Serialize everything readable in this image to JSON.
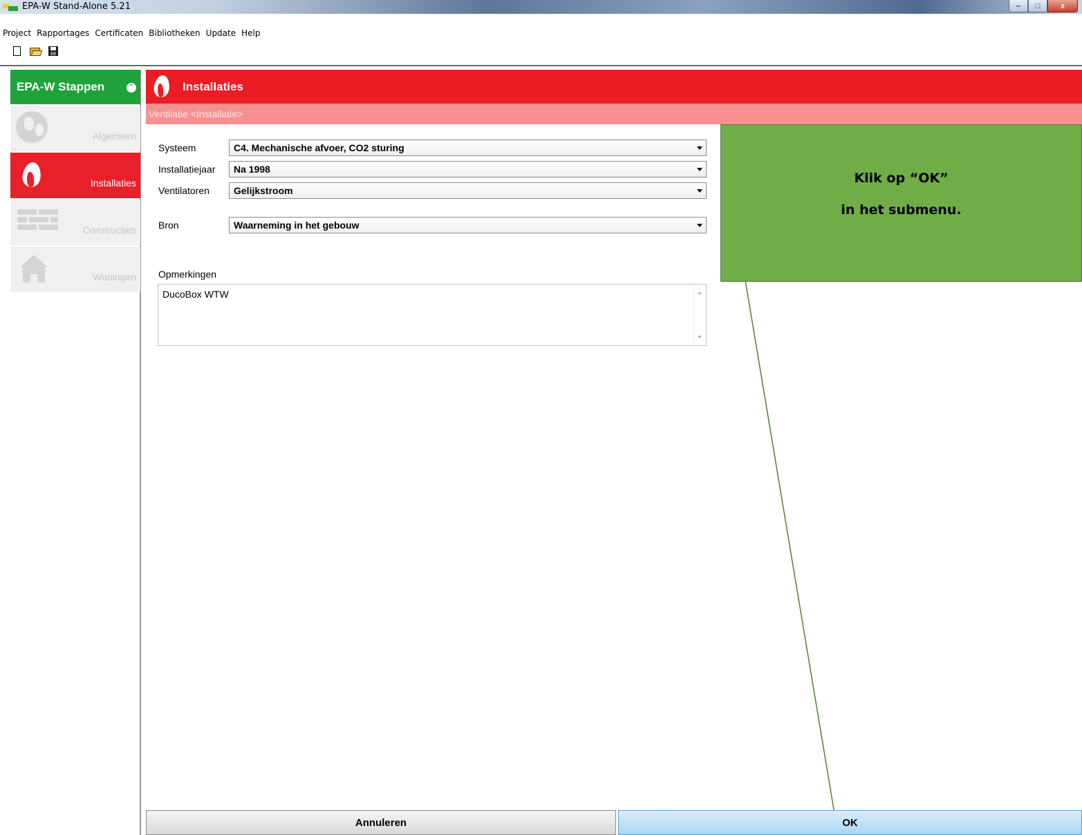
{
  "window": {
    "title": "EPA-W Stand-Alone 5.21",
    "minimize_glyph": "‒",
    "maximize_glyph": "□",
    "close_glyph": "x"
  },
  "menu": [
    "Project",
    "Rapportages",
    "Certificaten",
    "Bibliotheken",
    "Update",
    "Help"
  ],
  "toolbar": {
    "icons": [
      "new-file-icon",
      "open-folder-icon",
      "save-disk-icon"
    ]
  },
  "sidebar": {
    "header": "EPA-W Stappen",
    "collapse_glyph": "⌃",
    "items": [
      {
        "label": "Algemeen",
        "icon": "globe-icon",
        "active": false
      },
      {
        "label": "Installaties",
        "icon": "flame-icon",
        "active": true
      },
      {
        "label": "Constructies",
        "icon": "bricks-icon",
        "active": false
      },
      {
        "label": "Woningen",
        "icon": "house-icon",
        "active": false
      }
    ]
  },
  "main": {
    "title": "Installaties",
    "subtitle": "Ventilatie <Installatie>",
    "fields": {
      "systeem": {
        "label": "Systeem",
        "value": "C4. Mechanische afvoer, CO2 sturing"
      },
      "installatiejaar": {
        "label": "Installatiejaar",
        "value": "Na 1998"
      },
      "ventilatoren": {
        "label": "Ventilatoren",
        "value": "Gelijkstroom"
      },
      "bron": {
        "label": "Bron",
        "value": "Waarneming in het gebouw"
      }
    },
    "opmerkingen": {
      "label": "Opmerkingen",
      "value": "DucoBox WTW"
    }
  },
  "callout": {
    "line1": "Klik op “OK”",
    "line2": "in het submenu.",
    "color": "#70ad47"
  },
  "buttons": {
    "cancel": "Annuleren",
    "ok": "OK"
  },
  "colors": {
    "red": "#ec1c24",
    "green": "#1fa33a",
    "pink": "#f89090"
  }
}
